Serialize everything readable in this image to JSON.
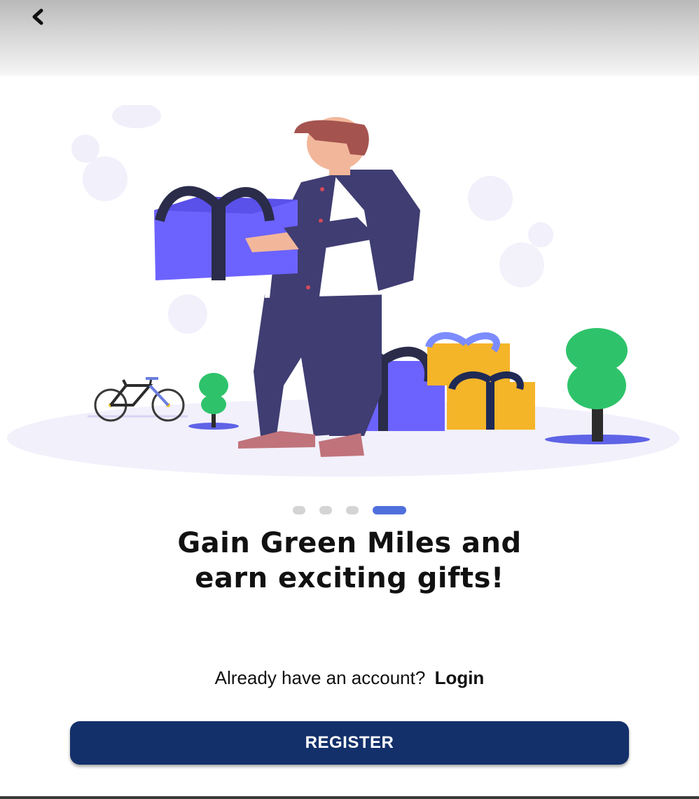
{
  "header": {
    "back_icon": "chevron-left-icon"
  },
  "illustration": {
    "subject": "man-holding-gift-box",
    "elements": [
      "bicycle-icon",
      "tree-icon",
      "gift-box-icon"
    ]
  },
  "pager": {
    "total": 4,
    "active_index": 3,
    "active_color": "#4f6fdc",
    "inactive_color": "#d4d4d4"
  },
  "content": {
    "headline_line1": "Gain Green Miles and",
    "headline_line2": "earn exciting gifts!"
  },
  "account": {
    "prompt": "Already have an account?",
    "login_label": "Login"
  },
  "actions": {
    "register_label": "REGISTER",
    "register_color": "#13306b"
  }
}
